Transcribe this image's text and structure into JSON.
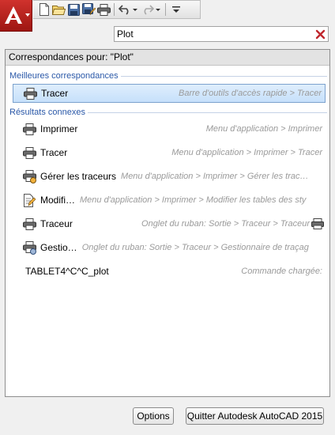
{
  "toolbar": {
    "app_button_icon": "autocad-logo-icon",
    "items": [
      {
        "icon": "new-file-icon"
      },
      {
        "icon": "open-folder-icon"
      },
      {
        "icon": "save-icon"
      },
      {
        "icon": "save-as-icon"
      },
      {
        "icon": "plot-printer-icon"
      },
      {
        "icon": "undo-icon"
      },
      {
        "icon": "redo-icon"
      },
      {
        "icon": "customize-menu-icon"
      }
    ]
  },
  "search": {
    "value": "Plot",
    "clear_icon": "clear-x-icon",
    "clear_color": "#c0272d"
  },
  "results": {
    "header": "Correspondances pour: \"Plot\"",
    "best_label": "Meilleures correspondances",
    "related_label": "Résultats connexes",
    "best": [
      {
        "name": "Tracer",
        "path": "Barre d'outils d'accès rapide > Tracer",
        "icon": "printer-icon"
      }
    ],
    "related": [
      {
        "name": "Imprimer",
        "path": "Menu d'application > Imprimer",
        "icon": "printer-icon"
      },
      {
        "name": "Tracer",
        "path": "Menu d'application > Imprimer > Tracer",
        "icon": "printer-icon"
      },
      {
        "name": "Gérer les traceurs",
        "path": "Menu d'application > Imprimer > Gérer les trac…",
        "icon": "plotter-manager-icon"
      },
      {
        "name": "Modifi…",
        "path": "Menu d'application > Imprimer > Modifier les tables des sty",
        "icon": "edit-plot-style-icon"
      },
      {
        "name": "Traceur",
        "path": "Onglet du ruban: Sortie > Traceur > Traceur",
        "icon": "printer-icon"
      },
      {
        "name": "Gestio…",
        "path": "Onglet du ruban: Sortie > Traceur > Gestionnaire de traçag",
        "icon": "plotter-manager-icon"
      },
      {
        "name": "TABLET4^C^C_plot",
        "path": "Commande chargée:",
        "icon": ""
      }
    ]
  },
  "buttons": {
    "options": "Options",
    "quit": "Quitter Autodesk AutoCAD 2015"
  },
  "colors": {
    "accent_red": "#c0272d",
    "group_label": "#2a58a8",
    "selected_bg": "#c6e0fb"
  }
}
